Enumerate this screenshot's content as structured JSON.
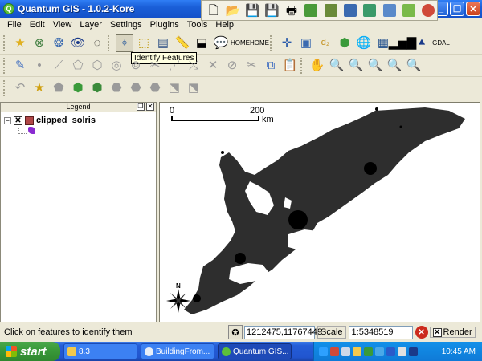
{
  "window": {
    "title": "Quantum GIS - 1.0.2-Kore",
    "app_icon": "Q"
  },
  "menu": [
    "File",
    "Edit",
    "View",
    "Layer",
    "Settings",
    "Plugins",
    "Tools",
    "Help"
  ],
  "tooltip": "Identify Features",
  "legend": {
    "title": "Legend",
    "layers": [
      {
        "name": "clipped_solris",
        "checked": "✕",
        "expander": "−"
      }
    ]
  },
  "map": {
    "scalebar": {
      "start": "0",
      "end": "200",
      "unit": "km"
    },
    "north_arrow": "N"
  },
  "status": {
    "message": "Click on features to identify them",
    "coordinates": "1212475,11767449",
    "scale_label": "Scale",
    "scale_value": "1:5348519",
    "render_label": "Render",
    "render_checked": "✕"
  },
  "taskbar": {
    "start_label": "start",
    "tasks": [
      {
        "label": "8.3",
        "icon_color": "#f2c94c"
      },
      {
        "label": "BuildingFrom...",
        "icon_color": "#e8eef8"
      },
      {
        "label": "Quantum GIS...",
        "icon_color": "#5cbf3a"
      }
    ],
    "clock": "10:45 AM"
  },
  "colors": {
    "titlebar": "#1a5fd8",
    "taskbar": "#245dd7",
    "start": "#3a9a3a",
    "map_features": "#000000"
  }
}
